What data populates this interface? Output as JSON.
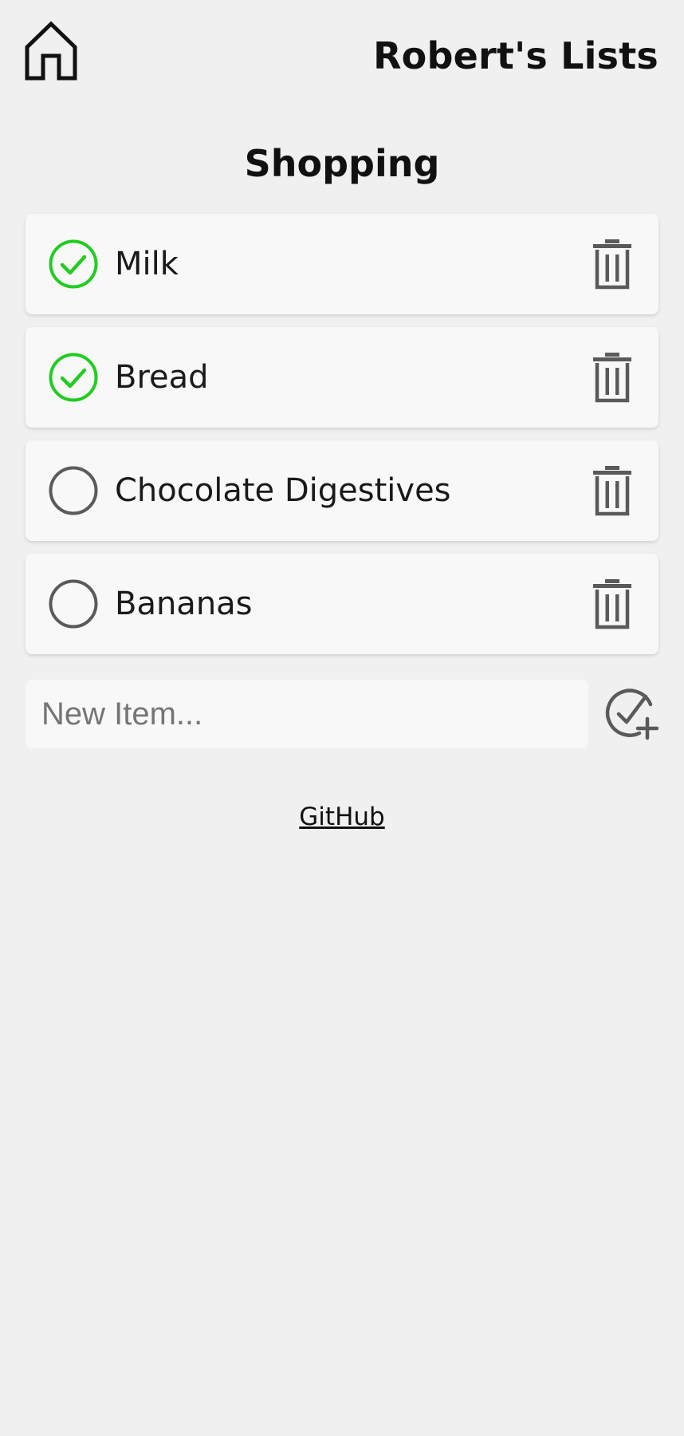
{
  "header": {
    "home_icon": "home-icon",
    "title": "Robert's Lists"
  },
  "list": {
    "title": "Shopping",
    "items": [
      {
        "label": "Milk",
        "checked": true
      },
      {
        "label": "Bread",
        "checked": true
      },
      {
        "label": "Chocolate Digestives",
        "checked": false
      },
      {
        "label": "Bananas",
        "checked": false
      }
    ],
    "check_icon": "check-circle-icon",
    "unchecked_icon": "circle-icon",
    "delete_icon": "trash-icon"
  },
  "new_item": {
    "placeholder": "New Item...",
    "value": "",
    "add_icon": "check-circle-plus-icon"
  },
  "footer": {
    "link_text": "GitHub"
  },
  "colors": {
    "background": "#f0f0f0",
    "card": "#f8f8f8",
    "checked_green": "#22cc22",
    "icon_gray": "#5a5a5a",
    "text": "#111111"
  }
}
